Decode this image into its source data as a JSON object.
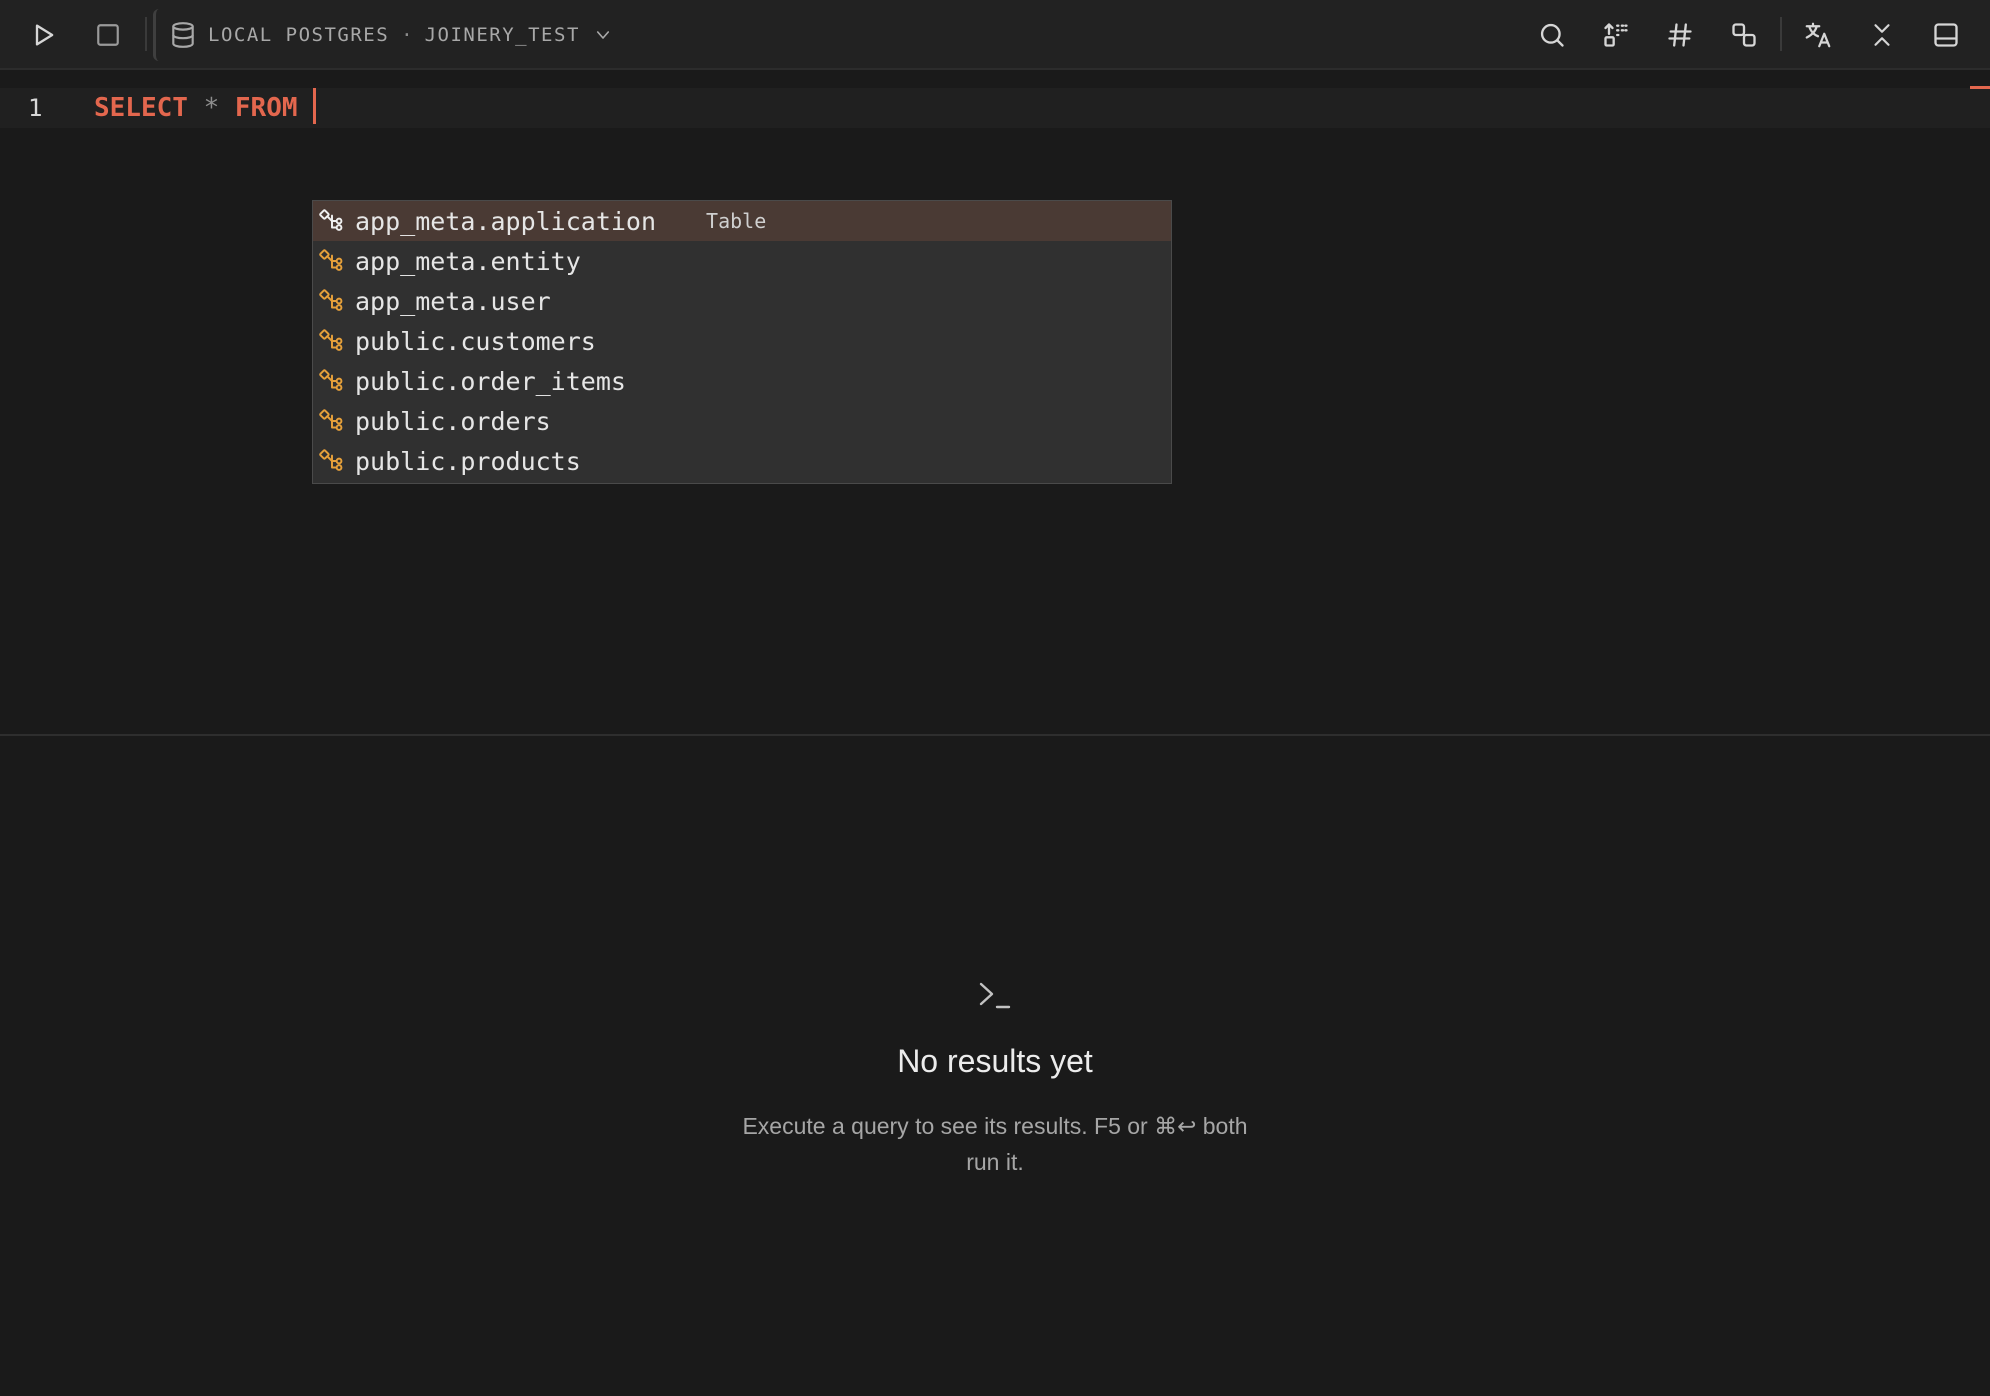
{
  "toolbar": {
    "run_icon": "play-icon",
    "stop_icon": "stop-icon",
    "connection_icon": "database-icon",
    "connection_name": "LOCAL POSTGRES",
    "connection_separator": "·",
    "database_name": "JOINERY_TEST",
    "dropdown_icon": "chevron-down-icon",
    "right_icons": [
      "search-icon",
      "format-icon",
      "hash-icon",
      "shapes-icon",
      "translate-icon",
      "collapse-icon",
      "panel-icon"
    ]
  },
  "editor": {
    "line_number": "1",
    "keyword_select": "SELECT",
    "operator_star": "*",
    "keyword_from": "FROM",
    "accent_color": "#e3674e"
  },
  "autocomplete": {
    "item_icon": "table-relation-icon",
    "selected_index": 0,
    "items": [
      {
        "label": "app_meta.application",
        "kind": "Table"
      },
      {
        "label": "app_meta.entity"
      },
      {
        "label": "app_meta.user"
      },
      {
        "label": "public.customers"
      },
      {
        "label": "public.order_items"
      },
      {
        "label": "public.orders"
      },
      {
        "label": "public.products"
      }
    ]
  },
  "results": {
    "icon": "terminal-prompt-icon",
    "title": "No results yet",
    "description": "Execute a query to see its results. F5 or ⌘↩ both run it."
  }
}
